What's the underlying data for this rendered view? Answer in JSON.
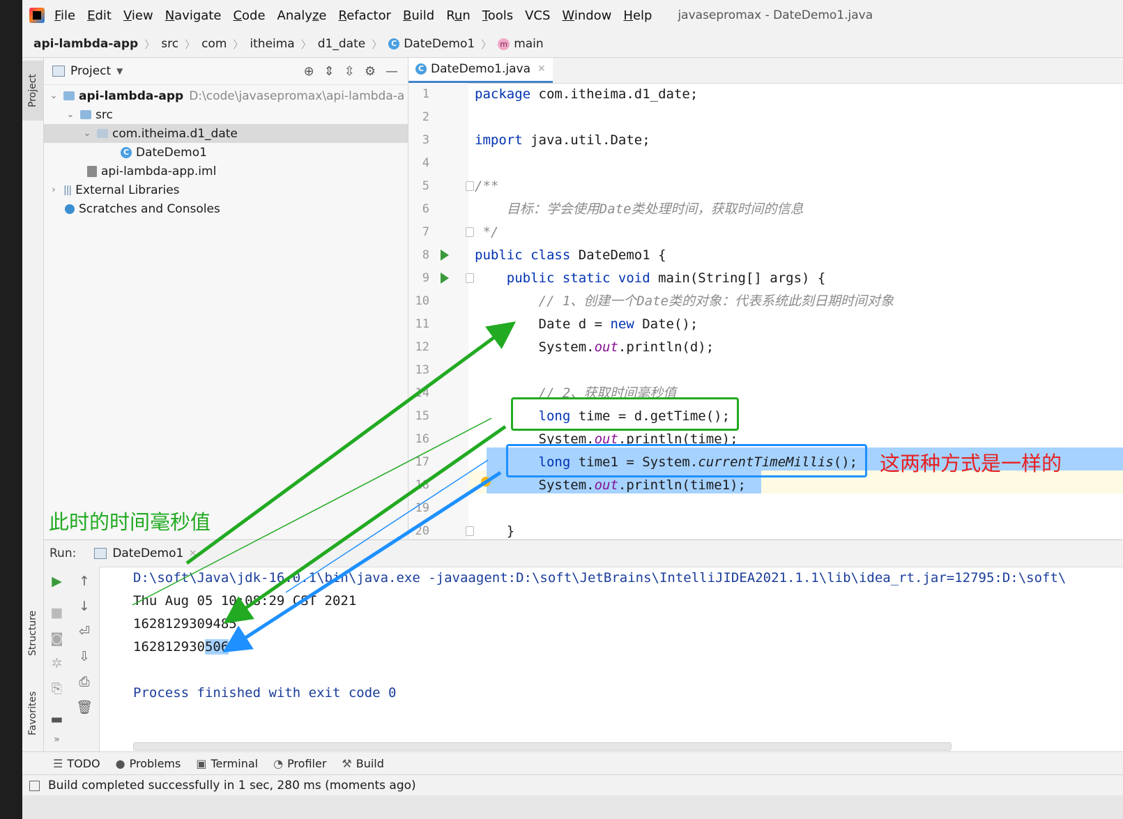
{
  "window": {
    "menu": [
      "File",
      "Edit",
      "View",
      "Navigate",
      "Code",
      "Analyze",
      "Refactor",
      "Build",
      "Run",
      "Tools",
      "VCS",
      "Window",
      "Help"
    ],
    "menu_mnemonics": [
      "F",
      "E",
      "V",
      "N",
      "C",
      "z",
      "R",
      "B",
      "u",
      "T",
      "",
      "W",
      "H"
    ],
    "title": "javasepromax - DateDemo1.java"
  },
  "breadcrumb": {
    "items": [
      "api-lambda-app",
      "src",
      "com",
      "itheima",
      "d1_date",
      "DateDemo1",
      "main"
    ]
  },
  "side_tabs": {
    "project": "Project",
    "structure": "Structure",
    "favorites": "Favorites"
  },
  "project_panel": {
    "title": "Project",
    "tree": [
      {
        "label": "api-lambda-app",
        "path": "D:\\code\\javasepromax\\api-lambda-a",
        "type": "module"
      },
      {
        "label": "src",
        "type": "folder"
      },
      {
        "label": "com.itheima.d1_date",
        "type": "package"
      },
      {
        "label": "DateDemo1",
        "type": "class"
      },
      {
        "label": "api-lambda-app.iml",
        "type": "iml"
      },
      {
        "label": "External Libraries",
        "type": "libraries"
      },
      {
        "label": "Scratches and Consoles",
        "type": "scratches"
      }
    ]
  },
  "editor": {
    "tab": "DateDemo1.java",
    "line_numbers": [
      "1",
      "2",
      "3",
      "4",
      "5",
      "6",
      "7",
      "8",
      "9",
      "10",
      "11",
      "12",
      "13",
      "14",
      "15",
      "16",
      "17",
      "18",
      "19",
      "20"
    ]
  },
  "run_panel": {
    "label": "Run:",
    "tab": "DateDemo1",
    "output": [
      "D:\\soft\\Java\\jdk-16.0.1\\bin\\java.exe -javaagent:D:\\soft\\JetBrains\\IntelliJIDEA2021.1.1\\lib\\idea_rt.jar=12795:D:\\soft\\",
      "Thu Aug 05 10:08:29 CST 2021",
      "1628129309485",
      "162812930",
      "506",
      "Process finished with exit code 0"
    ]
  },
  "bottom_tabs": [
    "TODO",
    "Problems",
    "Terminal",
    "Profiler",
    "Build"
  ],
  "status": "Build completed successfully in 1 sec, 280 ms (moments ago)",
  "annotations": {
    "same_note": "这两种方式是一样的",
    "millis_note": "此时的时间毫秒值"
  },
  "colors": {
    "keyword": "#0033b3",
    "comment": "#8c8c8c",
    "static_field": "#871094",
    "selection": "#a6d2ff",
    "green_annotation": "#22aa22",
    "blue_annotation": "#1e90ff",
    "red_annotation": "#e82020"
  }
}
